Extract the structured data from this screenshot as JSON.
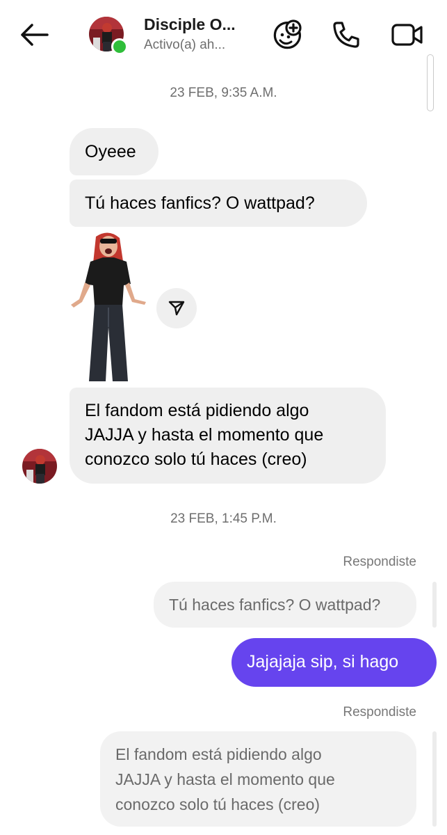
{
  "header": {
    "contact_name": "Disciple O...",
    "status": "Activo(a) ah..."
  },
  "messages": {
    "timestamp_1": "23 FEB, 9:35 A.M.",
    "msg_1": "Oyeee",
    "msg_2": "Tú haces fanfics? O wattpad?",
    "msg_3_lines": [
      "El fandom está pidiendo algo",
      "JAJJA y hasta el momento que",
      "conozco solo tú haces (creo)"
    ],
    "timestamp_2": "23 FEB, 1:45 P.M.",
    "replied_label_1": "Respondiste",
    "reply_quote_1": "Tú haces fanfics? O wattpad?",
    "out_msg_1": "Jajajaja sip, si hago",
    "replied_label_2": "Respondiste",
    "reply_quote_2_lines": [
      "El fandom está pidiendo algo",
      "JAJJA y hasta el momento que",
      "conozco solo tú haces (creo)"
    ]
  },
  "icons": {
    "back": "arrow-left-icon",
    "effects": "sticker-add-icon",
    "call": "phone-icon",
    "video": "video-camera-icon",
    "share": "send-icon"
  },
  "colors": {
    "outgoing_bubble": "#6644ee",
    "incoming_bubble": "#efefef",
    "online": "#2fbe3a"
  }
}
